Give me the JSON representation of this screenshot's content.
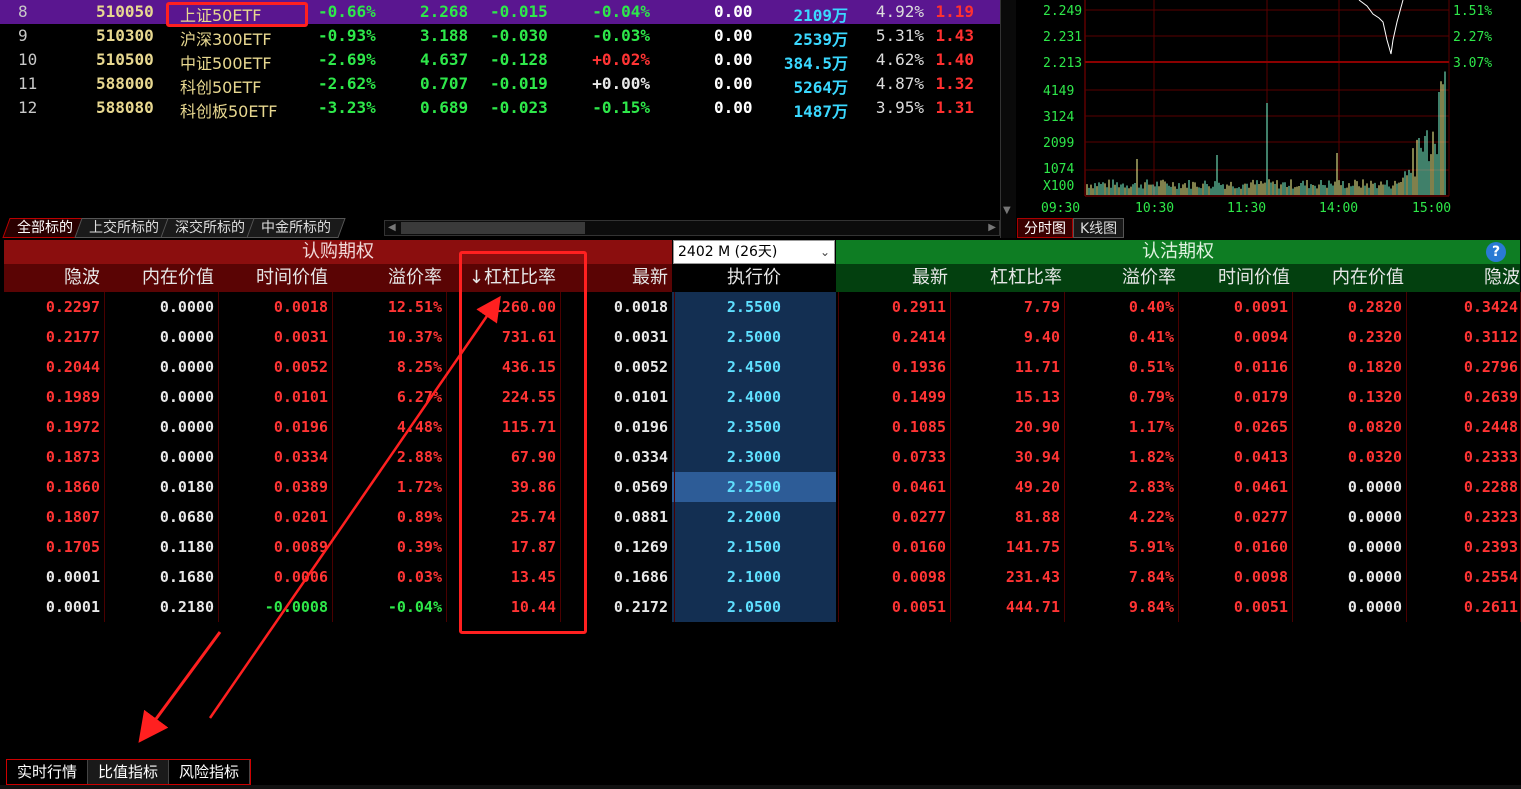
{
  "etf_rows": [
    {
      "idx": "8",
      "code": "510050",
      "name": "上证50ETF",
      "chg": "-0.66%",
      "price": "2.268",
      "diff": "-0.015",
      "pct2": "-0.04%",
      "pct2_color": "green",
      "zero": "0.00",
      "vol": "2109万",
      "rate": "4.92%",
      "last": "1.19",
      "selected": true
    },
    {
      "idx": "9",
      "code": "510300",
      "name": "沪深300ETF",
      "chg": "-0.93%",
      "price": "3.188",
      "diff": "-0.030",
      "pct2": "-0.03%",
      "pct2_color": "green",
      "zero": "0.00",
      "vol": "2539万",
      "rate": "5.31%",
      "last": "1.43"
    },
    {
      "idx": "10",
      "code": "510500",
      "name": "中证500ETF",
      "chg": "-2.69%",
      "price": "4.637",
      "diff": "-0.128",
      "pct2": "+0.02%",
      "pct2_color": "red",
      "zero": "0.00",
      "vol": "384.5万",
      "rate": "4.62%",
      "last": "1.40"
    },
    {
      "idx": "11",
      "code": "588000",
      "name": "科创50ETF",
      "chg": "-2.62%",
      "price": "0.707",
      "diff": "-0.019",
      "pct2": "+0.00%",
      "pct2_color": "white",
      "zero": "0.00",
      "vol": "5264万",
      "rate": "4.87%",
      "last": "1.32"
    },
    {
      "idx": "12",
      "code": "588080",
      "name": "科创板50ETF",
      "chg": "-3.23%",
      "price": "0.689",
      "diff": "-0.023",
      "pct2": "-0.15%",
      "pct2_color": "green",
      "zero": "0.00",
      "vol": "1487万",
      "rate": "3.95%",
      "last": "1.31"
    }
  ],
  "market_tabs": [
    "全部标的",
    "上交所标的",
    "深交所标的",
    "中金所标的"
  ],
  "chart_tabs": [
    "分时图",
    "K线图"
  ],
  "mini_chart": {
    "price_labels": [
      "2.249",
      "2.231",
      "2.213"
    ],
    "pct_labels": [
      "1.51%",
      "2.27%",
      "3.07%"
    ],
    "volume_labels": [
      "4149",
      "3124",
      "2099",
      "1074",
      "X100"
    ],
    "time_labels": [
      "09:30",
      "10:30",
      "11:30",
      "14:00",
      "15:00"
    ],
    "line_color": "#ffffff",
    "volume_color": "#7fffd4",
    "volume_up_color": "#ffff99"
  },
  "option_table": {
    "call_title": "认购期权",
    "put_title": "认沽期权",
    "expiry": "2402 M (26天)",
    "call_columns": [
      "隐波",
      "内在价值",
      "时间价值",
      "溢价率",
      "↓杠杠比率",
      "最新"
    ],
    "strike_column": "执行价",
    "put_columns": [
      "最新",
      "杠杠比率",
      "溢价率",
      "时间价值",
      "内在价值",
      "隐波"
    ],
    "rows": [
      {
        "c_iv": "0.2297",
        "c_in": "0.0000",
        "c_tv": "0.0018",
        "c_prem": "12.51%",
        "c_lev": "1260.00",
        "c_last": "0.0018",
        "strike": "2.5500",
        "p_last": "0.2911",
        "p_lev": "7.79",
        "p_prem": "0.40%",
        "p_tv": "0.0091",
        "p_in": "0.2820",
        "p_iv": "0.3424"
      },
      {
        "c_iv": "0.2177",
        "c_in": "0.0000",
        "c_tv": "0.0031",
        "c_prem": "10.37%",
        "c_lev": "731.61",
        "c_last": "0.0031",
        "strike": "2.5000",
        "p_last": "0.2414",
        "p_lev": "9.40",
        "p_prem": "0.41%",
        "p_tv": "0.0094",
        "p_in": "0.2320",
        "p_iv": "0.3112"
      },
      {
        "c_iv": "0.2044",
        "c_in": "0.0000",
        "c_tv": "0.0052",
        "c_prem": "8.25%",
        "c_lev": "436.15",
        "c_last": "0.0052",
        "strike": "2.4500",
        "p_last": "0.1936",
        "p_lev": "11.71",
        "p_prem": "0.51%",
        "p_tv": "0.0116",
        "p_in": "0.1820",
        "p_iv": "0.2796"
      },
      {
        "c_iv": "0.1989",
        "c_in": "0.0000",
        "c_tv": "0.0101",
        "c_prem": "6.27%",
        "c_lev": "224.55",
        "c_last": "0.0101",
        "strike": "2.4000",
        "p_last": "0.1499",
        "p_lev": "15.13",
        "p_prem": "0.79%",
        "p_tv": "0.0179",
        "p_in": "0.1320",
        "p_iv": "0.2639"
      },
      {
        "c_iv": "0.1972",
        "c_in": "0.0000",
        "c_tv": "0.0196",
        "c_prem": "4.48%",
        "c_lev": "115.71",
        "c_last": "0.0196",
        "strike": "2.3500",
        "p_last": "0.1085",
        "p_lev": "20.90",
        "p_prem": "1.17%",
        "p_tv": "0.0265",
        "p_in": "0.0820",
        "p_iv": "0.2448"
      },
      {
        "c_iv": "0.1873",
        "c_in": "0.0000",
        "c_tv": "0.0334",
        "c_prem": "2.88%",
        "c_lev": "67.90",
        "c_last": "0.0334",
        "strike": "2.3000",
        "p_last": "0.0733",
        "p_lev": "30.94",
        "p_prem": "1.82%",
        "p_tv": "0.0413",
        "p_in": "0.0320",
        "p_iv": "0.2333"
      },
      {
        "c_iv": "0.1860",
        "c_in": "0.0180",
        "c_tv": "0.0389",
        "c_prem": "1.72%",
        "c_lev": "39.86",
        "c_last": "0.0569",
        "strike": "2.2500",
        "p_last": "0.0461",
        "p_lev": "49.20",
        "p_prem": "2.83%",
        "p_tv": "0.0461",
        "p_in": "0.0000",
        "p_iv": "0.2288",
        "highlight": true
      },
      {
        "c_iv": "0.1807",
        "c_in": "0.0680",
        "c_tv": "0.0201",
        "c_prem": "0.89%",
        "c_lev": "25.74",
        "c_last": "0.0881",
        "strike": "2.2000",
        "p_last": "0.0277",
        "p_lev": "81.88",
        "p_prem": "4.22%",
        "p_tv": "0.0277",
        "p_in": "0.0000",
        "p_iv": "0.2323"
      },
      {
        "c_iv": "0.1705",
        "c_in": "0.1180",
        "c_tv": "0.0089",
        "c_prem": "0.39%",
        "c_lev": "17.87",
        "c_last": "0.1269",
        "strike": "2.1500",
        "p_last": "0.0160",
        "p_lev": "141.75",
        "p_prem": "5.91%",
        "p_tv": "0.0160",
        "p_in": "0.0000",
        "p_iv": "0.2393"
      },
      {
        "c_iv": "0.0001",
        "c_in": "0.1680",
        "c_tv": "0.0006",
        "c_prem": "0.03%",
        "c_lev": "13.45",
        "c_last": "0.1686",
        "strike": "2.1000",
        "p_last": "0.0098",
        "p_lev": "231.43",
        "p_prem": "7.84%",
        "p_tv": "0.0098",
        "p_in": "0.0000",
        "p_iv": "0.2554",
        "c_iv_white": true
      },
      {
        "c_iv": "0.0001",
        "c_in": "0.2180",
        "c_tv": "-0.0008",
        "c_prem": "-0.04%",
        "c_lev": "10.44",
        "c_last": "0.2172",
        "strike": "2.0500",
        "p_last": "0.0051",
        "p_lev": "444.71",
        "p_prem": "9.84%",
        "p_tv": "0.0051",
        "p_in": "0.0000",
        "p_iv": "0.2611",
        "c_iv_white": true,
        "c_tv_green": true,
        "c_prem_green": true
      }
    ]
  },
  "bottom_tabs": [
    "实时行情",
    "比值指标",
    "风险指标"
  ],
  "annotation_color": "#ff2020"
}
